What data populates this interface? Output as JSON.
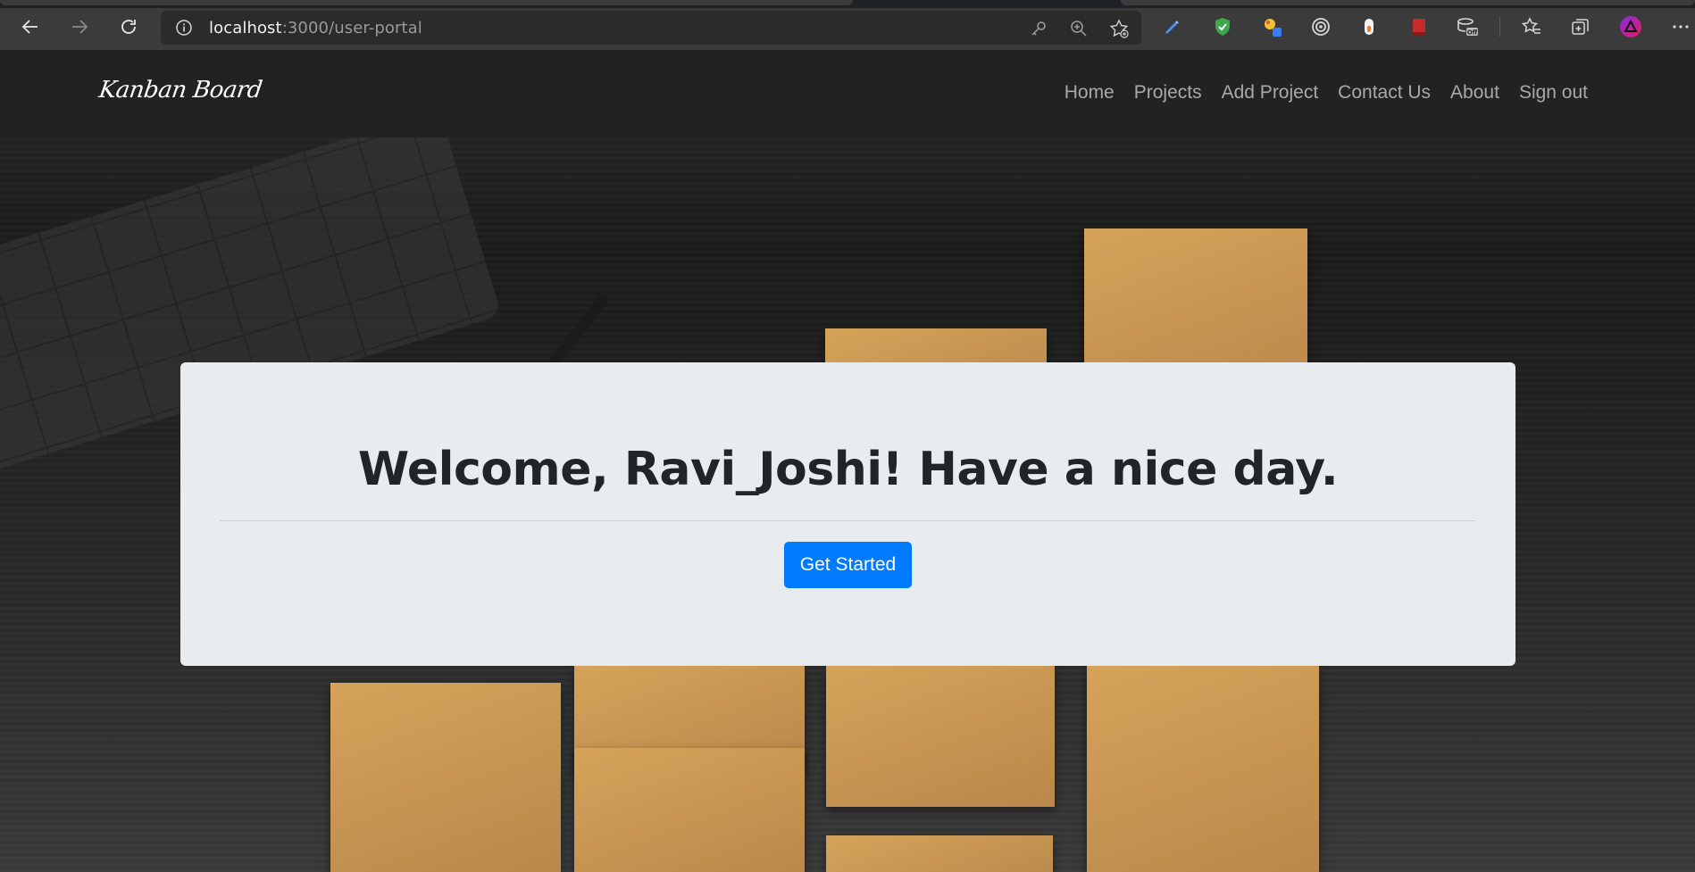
{
  "browser": {
    "url_host": "localhost",
    "url_path": ":3000/user-portal",
    "extensions": [
      "pen-extension-icon",
      "shield-extension-icon",
      "color-picker-extension-icon",
      "target-extension-icon",
      "mouse-extension-icon",
      "book-extension-icon",
      "cache-extension-icon"
    ],
    "ext_badge": "Off"
  },
  "navbar": {
    "brand": "Kanban Board",
    "links": [
      "Home",
      "Projects",
      "Add Project",
      "Contact Us",
      "About",
      "Sign out"
    ]
  },
  "jumbotron": {
    "welcome": "Welcome, Ravi_Joshi! Have a nice day.",
    "button": "Get Started"
  },
  "colors": {
    "primary": "#007bff",
    "navbar_bg": "#222222",
    "jumbotron_bg": "#e9ecef"
  }
}
